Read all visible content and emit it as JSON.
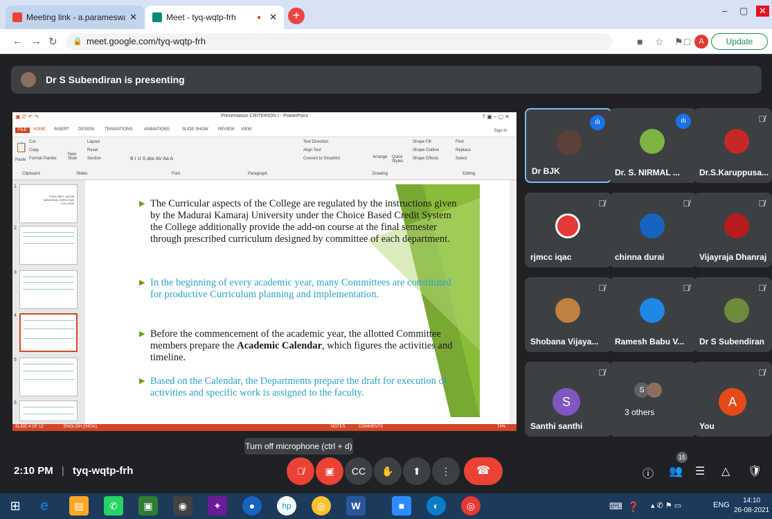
{
  "browser": {
    "tabs": [
      {
        "title": "Meeting link - a.parameswari@g",
        "close": "✕"
      },
      {
        "title": "Meet - tyq-wqtp-frh",
        "close": "✕"
      }
    ],
    "new_tab": "+",
    "window_controls": {
      "minimize": "–",
      "maximize": "▢",
      "close": "✕"
    },
    "url": "meet.google.com/tyq-wqtp-frh",
    "update_label": "Update",
    "profile_letter": "A"
  },
  "meet": {
    "presenting_label": "Dr S Subendiran is presenting",
    "tooltip": "Turn off microphone (ctrl + d)",
    "time": "2:10 PM",
    "meeting_code": "tyq-wqtp-frh",
    "participant_count": "15",
    "participants": [
      {
        "name": "Dr BJK",
        "speaking": true
      },
      {
        "name": "Dr. S. NIRMAL ...",
        "speaking": true
      },
      {
        "name": "Dr.S.Karuppusa...",
        "speaking": false
      },
      {
        "name": "rjmcc iqac",
        "speaking": false
      },
      {
        "name": "chinna durai",
        "speaking": false
      },
      {
        "name": "Vijayraja Dhanraj",
        "speaking": false
      },
      {
        "name": "Shobana Vijaya...",
        "speaking": false
      },
      {
        "name": "Ramesh Babu V...",
        "speaking": false
      },
      {
        "name": "Dr S Subendiran",
        "speaking": false
      },
      {
        "name": "Santhi santhi",
        "letter": "S"
      },
      {
        "name": "3 others",
        "letter": "S"
      },
      {
        "name": "You",
        "letter": "A"
      }
    ]
  },
  "ppt": {
    "title": "Presentation CRITERION I - PowerPoint",
    "sign_in": "Sign in",
    "tabs": [
      "FILE",
      "HOME",
      "INSERT",
      "DESIGN",
      "TRANSITIONS",
      "ANIMATIONS",
      "SLIDE SHOW",
      "REVIEW",
      "VIEW"
    ],
    "ribbon_groups": [
      "Clipboard",
      "Slides",
      "Font",
      "Paragraph",
      "Drawing",
      "Editing"
    ],
    "ribbon_items": {
      "cut": "Cut",
      "copy": "Copy",
      "format_painter": "Format Painter",
      "paste": "Paste",
      "new_slide": "New Slide",
      "layout": "Layout",
      "reset": "Reset",
      "section": "Section",
      "text_direction": "Text Direction",
      "align_text": "Align Text",
      "convert": "Convert to SmartArt",
      "arrange": "Arrange",
      "quick_styles": "Quick Styles",
      "shape_fill": "Shape Fill",
      "shape_outline": "Shape Outline",
      "shape_effects": "Shape Effects",
      "find": "Find",
      "replace": "Replace",
      "select": "Select"
    },
    "thumb_numbers": [
      "1",
      "2",
      "3",
      "4",
      "5",
      "6"
    ],
    "thumb1_text": "RJMC REV. JACOB MEMORIAL CHRISTIAN COLLEGE",
    "status": {
      "slide": "SLIDE 4 OF 12",
      "lang": "ENGLISH (INDIA)",
      "notes": "NOTES",
      "comments": "COMMENTS",
      "zoom": "74%"
    },
    "bullets": [
      {
        "text": "The Curricular aspects of the College are regulated by the instructions  given by the Madurai Kamaraj University  under  the Choice Based Credit System  the  College additionally provide the add-on course at the final  semester through prescribed curriculum designed by committee of each department.",
        "color": "#1a1a1a"
      },
      {
        "text": "In the beginning of every academic year, many Committees are constituted for productive Curriculum planning and implementation.",
        "color": "#2aa3c9"
      },
      {
        "text_before": "Before the commencement of the academic year, the allotted Committee members prepare the ",
        "bold": "Academic Calendar",
        "text_after": ", which figures the activities and timeline.",
        "color": "#1a1a1a"
      },
      {
        "text": "Based on the Calendar, the Departments prepare the draft for execution of activities and specific work is assigned to the faculty.",
        "color": "#2aa3c9"
      }
    ]
  },
  "taskbar": {
    "lang": "ENG",
    "time": "14:10",
    "date": "26-08-2021"
  },
  "colors": {
    "accent": "#1a73e8",
    "danger": "#ea4335",
    "ppt": "#d24726",
    "slide_green": "#6a9e1f"
  }
}
